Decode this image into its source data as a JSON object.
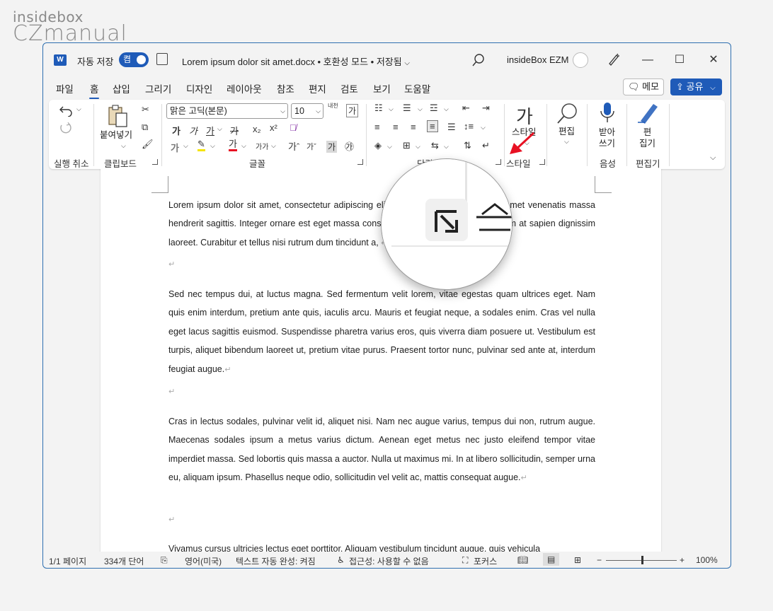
{
  "brand": {
    "line1": "insidebox",
    "line2": "CZmanual"
  },
  "titlebar": {
    "word_logo": "W",
    "autosave_label": "자동 저장",
    "toggle_label": "켬",
    "doc_title": "Lorem ipsum dolor sit amet.docx  •  호환성 모드 • 저장됨",
    "account_name": "insideBox EZM",
    "icons": [
      "word-icon",
      "save-icon",
      "search-icon",
      "avatar",
      "designer-pen-icon",
      "minimize-icon",
      "maximize-icon",
      "close-icon"
    ]
  },
  "menubar": {
    "tabs": [
      "파일",
      "홈",
      "삽입",
      "그리기",
      "디자인",
      "레이아웃",
      "참조",
      "편지",
      "검토",
      "보기",
      "도움말"
    ],
    "active_tab": "홈",
    "memo_label": "메모",
    "share_label": "공유"
  },
  "ribbon": {
    "groups": {
      "undo": "실행 취소",
      "clipboard": "클립보드",
      "font": "글꼴",
      "paragraph": "단락",
      "styles": "스타일",
      "voice": "음성",
      "editor": "편집기"
    },
    "paste_label": "붙여넣기",
    "font_name": "맑은 고딕(본문)",
    "font_size": "10",
    "styles_label": "스타일",
    "editing_label": "편집",
    "dictate_label": "받아\n쓰기",
    "editor_label": "편\n집기",
    "font_buttons": {
      "bold": "가",
      "italic": "가",
      "underline": "가",
      "strike": "가",
      "subscript": "x₂",
      "superscript": "x²",
      "grow": "가ˆ",
      "shrink": "가ˇ",
      "change_case": "가가",
      "font_color": "가",
      "phonetic": "내천",
      "char_shading": "가",
      "enclose": "㉮"
    },
    "accent_colors": {
      "highlight": "#f5e400",
      "font_color": "#e81123",
      "brand_blue": "#1f5bb8"
    }
  },
  "document": {
    "paragraphs": [
      "Lorem ipsum dolor sit amet, consectetur adipiscing elit. Nullam ac magna nunc, sit amet venenatis massa hendrerit sagittis. Integer ornare est eget massa consequat tellus facilisis. Nulla id enim at sapien dignissim laoreet. Curabitur et tellus nisi rutrum dum tincidunt a,",
      "Sed nec tempus dui, at luctus magna. Sed fermentum velit lorem, vitae egestas quam ultrices eget. Nam quis enim interdum, pretium ante quis, iaculis arcu. Mauris et feugiat neque, a sodales enim. Cras vel nulla eget lacus sagittis euismod. Suspendisse pharetra varius eros, quis viverra diam posuere ut. Vestibulum est turpis, aliquet bibendum laoreet ut, pretium vitae purus. Praesent tortor nunc, pulvinar sed ante at, interdum feugiat augue.",
      "Cras in lectus sodales, pulvinar velit id, aliquet nisi. Nam nec augue varius, tempus dui non, rutrum augue. Maecenas sodales ipsum a metus varius dictum. Aenean eget metus nec justo eleifend tempor vitae imperdiet massa. Sed lobortis quis massa a auctor. Nulla ut maximus mi. In at libero sollicitudin, semper urna eu, aliquam ipsum. Phasellus neque odio, sollicitudin vel velit ac, mattis consequat augue.",
      "Vivamus cursus ultricies lectus eget porttitor. Aliquam vestibulum tincidunt augue, quis vehicula"
    ],
    "paragraph_mark": "↵"
  },
  "statusbar": {
    "page": "1/1 페이지",
    "words": "334개 단어",
    "language": "영어(미국)",
    "autocomplete": "텍스트 자동 완성: 켜짐",
    "accessibility": "접근성: 사용할 수 없음",
    "focus": "포커스",
    "zoom_minus": "−",
    "zoom_plus": "+",
    "zoom": "100%",
    "zoom_level": 1.0
  }
}
